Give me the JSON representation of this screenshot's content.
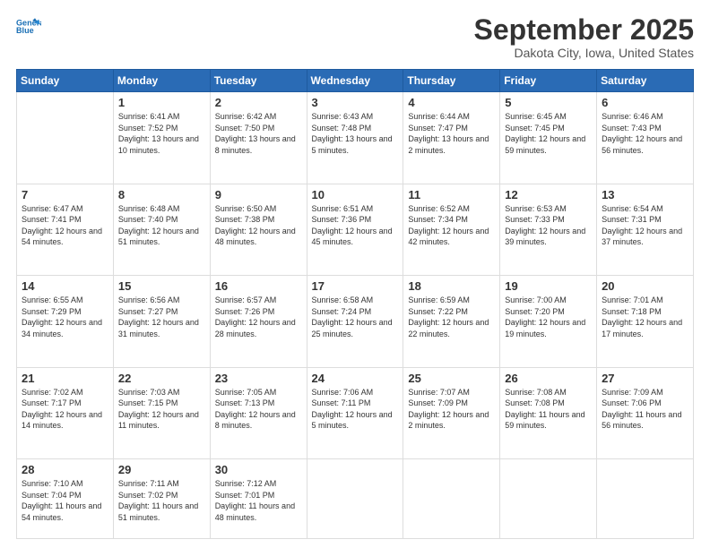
{
  "header": {
    "logo_line1": "General",
    "logo_line2": "Blue",
    "month": "September 2025",
    "location": "Dakota City, Iowa, United States"
  },
  "weekdays": [
    "Sunday",
    "Monday",
    "Tuesday",
    "Wednesday",
    "Thursday",
    "Friday",
    "Saturday"
  ],
  "weeks": [
    [
      {
        "day": "",
        "sunrise": "",
        "sunset": "",
        "daylight": ""
      },
      {
        "day": "1",
        "sunrise": "Sunrise: 6:41 AM",
        "sunset": "Sunset: 7:52 PM",
        "daylight": "Daylight: 13 hours and 10 minutes."
      },
      {
        "day": "2",
        "sunrise": "Sunrise: 6:42 AM",
        "sunset": "Sunset: 7:50 PM",
        "daylight": "Daylight: 13 hours and 8 minutes."
      },
      {
        "day": "3",
        "sunrise": "Sunrise: 6:43 AM",
        "sunset": "Sunset: 7:48 PM",
        "daylight": "Daylight: 13 hours and 5 minutes."
      },
      {
        "day": "4",
        "sunrise": "Sunrise: 6:44 AM",
        "sunset": "Sunset: 7:47 PM",
        "daylight": "Daylight: 13 hours and 2 minutes."
      },
      {
        "day": "5",
        "sunrise": "Sunrise: 6:45 AM",
        "sunset": "Sunset: 7:45 PM",
        "daylight": "Daylight: 12 hours and 59 minutes."
      },
      {
        "day": "6",
        "sunrise": "Sunrise: 6:46 AM",
        "sunset": "Sunset: 7:43 PM",
        "daylight": "Daylight: 12 hours and 56 minutes."
      }
    ],
    [
      {
        "day": "7",
        "sunrise": "Sunrise: 6:47 AM",
        "sunset": "Sunset: 7:41 PM",
        "daylight": "Daylight: 12 hours and 54 minutes."
      },
      {
        "day": "8",
        "sunrise": "Sunrise: 6:48 AM",
        "sunset": "Sunset: 7:40 PM",
        "daylight": "Daylight: 12 hours and 51 minutes."
      },
      {
        "day": "9",
        "sunrise": "Sunrise: 6:50 AM",
        "sunset": "Sunset: 7:38 PM",
        "daylight": "Daylight: 12 hours and 48 minutes."
      },
      {
        "day": "10",
        "sunrise": "Sunrise: 6:51 AM",
        "sunset": "Sunset: 7:36 PM",
        "daylight": "Daylight: 12 hours and 45 minutes."
      },
      {
        "day": "11",
        "sunrise": "Sunrise: 6:52 AM",
        "sunset": "Sunset: 7:34 PM",
        "daylight": "Daylight: 12 hours and 42 minutes."
      },
      {
        "day": "12",
        "sunrise": "Sunrise: 6:53 AM",
        "sunset": "Sunset: 7:33 PM",
        "daylight": "Daylight: 12 hours and 39 minutes."
      },
      {
        "day": "13",
        "sunrise": "Sunrise: 6:54 AM",
        "sunset": "Sunset: 7:31 PM",
        "daylight": "Daylight: 12 hours and 37 minutes."
      }
    ],
    [
      {
        "day": "14",
        "sunrise": "Sunrise: 6:55 AM",
        "sunset": "Sunset: 7:29 PM",
        "daylight": "Daylight: 12 hours and 34 minutes."
      },
      {
        "day": "15",
        "sunrise": "Sunrise: 6:56 AM",
        "sunset": "Sunset: 7:27 PM",
        "daylight": "Daylight: 12 hours and 31 minutes."
      },
      {
        "day": "16",
        "sunrise": "Sunrise: 6:57 AM",
        "sunset": "Sunset: 7:26 PM",
        "daylight": "Daylight: 12 hours and 28 minutes."
      },
      {
        "day": "17",
        "sunrise": "Sunrise: 6:58 AM",
        "sunset": "Sunset: 7:24 PM",
        "daylight": "Daylight: 12 hours and 25 minutes."
      },
      {
        "day": "18",
        "sunrise": "Sunrise: 6:59 AM",
        "sunset": "Sunset: 7:22 PM",
        "daylight": "Daylight: 12 hours and 22 minutes."
      },
      {
        "day": "19",
        "sunrise": "Sunrise: 7:00 AM",
        "sunset": "Sunset: 7:20 PM",
        "daylight": "Daylight: 12 hours and 19 minutes."
      },
      {
        "day": "20",
        "sunrise": "Sunrise: 7:01 AM",
        "sunset": "Sunset: 7:18 PM",
        "daylight": "Daylight: 12 hours and 17 minutes."
      }
    ],
    [
      {
        "day": "21",
        "sunrise": "Sunrise: 7:02 AM",
        "sunset": "Sunset: 7:17 PM",
        "daylight": "Daylight: 12 hours and 14 minutes."
      },
      {
        "day": "22",
        "sunrise": "Sunrise: 7:03 AM",
        "sunset": "Sunset: 7:15 PM",
        "daylight": "Daylight: 12 hours and 11 minutes."
      },
      {
        "day": "23",
        "sunrise": "Sunrise: 7:05 AM",
        "sunset": "Sunset: 7:13 PM",
        "daylight": "Daylight: 12 hours and 8 minutes."
      },
      {
        "day": "24",
        "sunrise": "Sunrise: 7:06 AM",
        "sunset": "Sunset: 7:11 PM",
        "daylight": "Daylight: 12 hours and 5 minutes."
      },
      {
        "day": "25",
        "sunrise": "Sunrise: 7:07 AM",
        "sunset": "Sunset: 7:09 PM",
        "daylight": "Daylight: 12 hours and 2 minutes."
      },
      {
        "day": "26",
        "sunrise": "Sunrise: 7:08 AM",
        "sunset": "Sunset: 7:08 PM",
        "daylight": "Daylight: 11 hours and 59 minutes."
      },
      {
        "day": "27",
        "sunrise": "Sunrise: 7:09 AM",
        "sunset": "Sunset: 7:06 PM",
        "daylight": "Daylight: 11 hours and 56 minutes."
      }
    ],
    [
      {
        "day": "28",
        "sunrise": "Sunrise: 7:10 AM",
        "sunset": "Sunset: 7:04 PM",
        "daylight": "Daylight: 11 hours and 54 minutes."
      },
      {
        "day": "29",
        "sunrise": "Sunrise: 7:11 AM",
        "sunset": "Sunset: 7:02 PM",
        "daylight": "Daylight: 11 hours and 51 minutes."
      },
      {
        "day": "30",
        "sunrise": "Sunrise: 7:12 AM",
        "sunset": "Sunset: 7:01 PM",
        "daylight": "Daylight: 11 hours and 48 minutes."
      },
      {
        "day": "",
        "sunrise": "",
        "sunset": "",
        "daylight": ""
      },
      {
        "day": "",
        "sunrise": "",
        "sunset": "",
        "daylight": ""
      },
      {
        "day": "",
        "sunrise": "",
        "sunset": "",
        "daylight": ""
      },
      {
        "day": "",
        "sunrise": "",
        "sunset": "",
        "daylight": ""
      }
    ]
  ]
}
